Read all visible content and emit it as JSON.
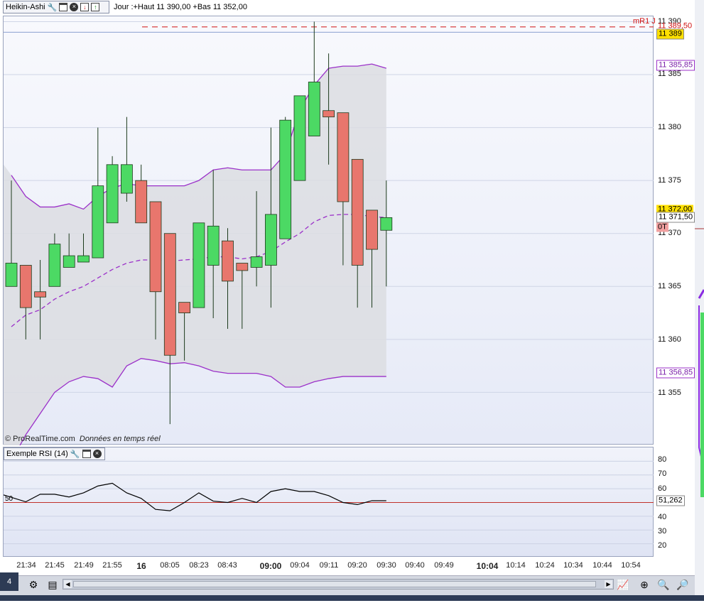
{
  "toolbar": {
    "indicator_name": "Heikin-Ashi",
    "day_info": "Jour :+Haut 11 390,00 +Bas 11 352,00",
    "rsi_name": "Exemple RSI (14)"
  },
  "watermark": {
    "source": "© ProRealTime.com",
    "note": "Données en temps réel"
  },
  "price_axis": {
    "ticks": [
      "11 390",
      "11 385",
      "11 380",
      "11 375",
      "11 370",
      "11 365",
      "11 360",
      "11 355"
    ],
    "tags": {
      "r1_label": "mR1 J",
      "r1_value": "11 389,50",
      "last_price": "11 389",
      "bb_upper": "11 385,85",
      "price_current": "11 372,00",
      "ma_value": "11 371,50",
      "ot_label": "0T",
      "bb_lower": "11 356,85"
    }
  },
  "rsi_axis": {
    "ticks": [
      "80",
      "70",
      "60",
      "50",
      "40",
      "30",
      "20"
    ],
    "level_label": "50",
    "current_value": "51,262"
  },
  "time_axis": {
    "labels": [
      "21:34",
      "21:45",
      "21:49",
      "21:55",
      "16",
      "08:05",
      "08:23",
      "08:43",
      "09:00",
      "09:04",
      "09:11",
      "09:20",
      "09:30",
      "09:40",
      "09:49",
      "10:04",
      "10:14",
      "10:24",
      "10:34",
      "10:44",
      "10:54"
    ],
    "bold": [
      "16",
      "09:00",
      "10:04"
    ]
  },
  "bottom": {
    "page_badge": "4"
  },
  "colors": {
    "bull": "#4cd964",
    "bear": "#e8766d",
    "band": "#9b30c9",
    "band_fill": "#dcdde2",
    "r1_line": "#d01010",
    "rsi_line": "#000000",
    "rsi_level": "#c0302b"
  },
  "chart_data": {
    "type": "candlestick",
    "ylim": [
      11350,
      11390.5
    ],
    "candles": [
      {
        "o": 11365,
        "c": 11367.2,
        "h": 11375,
        "l": 11365,
        "dir": "up"
      },
      {
        "o": 11367,
        "c": 11363,
        "h": 11367,
        "l": 11360,
        "dir": "down"
      },
      {
        "o": 11364.5,
        "c": 11364,
        "h": 11367.5,
        "l": 11360,
        "dir": "down"
      },
      {
        "o": 11365,
        "c": 11369,
        "h": 11370,
        "l": 11365,
        "dir": "up"
      },
      {
        "o": 11366.8,
        "c": 11367.9,
        "h": 11370,
        "l": 11366.8,
        "dir": "up"
      },
      {
        "o": 11367.3,
        "c": 11367.9,
        "h": 11370,
        "l": 11367.3,
        "dir": "up"
      },
      {
        "o": 11367.7,
        "c": 11374.5,
        "h": 11380,
        "l": 11367.7,
        "dir": "up"
      },
      {
        "o": 11371,
        "c": 11376.5,
        "h": 11377.3,
        "l": 11371,
        "dir": "up"
      },
      {
        "o": 11373.8,
        "c": 11376.5,
        "h": 11381,
        "l": 11373,
        "dir": "up"
      },
      {
        "o": 11375,
        "c": 11371,
        "h": 11376.5,
        "l": 11371,
        "dir": "down"
      },
      {
        "o": 11373,
        "c": 11364.5,
        "h": 11373,
        "l": 11360,
        "dir": "down"
      },
      {
        "o": 11370,
        "c": 11358.5,
        "h": 11370,
        "l": 11352,
        "dir": "down"
      },
      {
        "o": 11363.5,
        "c": 11362.5,
        "h": 11363.5,
        "l": 11358,
        "dir": "down"
      },
      {
        "o": 11363,
        "c": 11371,
        "h": 11371,
        "l": 11363,
        "dir": "up"
      },
      {
        "o": 11367,
        "c": 11370.7,
        "h": 11376,
        "l": 11362,
        "dir": "up"
      },
      {
        "o": 11369.3,
        "c": 11365.5,
        "h": 11370.5,
        "l": 11361,
        "dir": "down"
      },
      {
        "o": 11367.2,
        "c": 11366.5,
        "h": 11367.2,
        "l": 11361,
        "dir": "down"
      },
      {
        "o": 11366.8,
        "c": 11367.8,
        "h": 11374,
        "l": 11365,
        "dir": "up"
      },
      {
        "o": 11367,
        "c": 11371.8,
        "h": 11380,
        "l": 11363,
        "dir": "up"
      },
      {
        "o": 11369.5,
        "c": 11380.7,
        "h": 11381,
        "l": 11369.5,
        "dir": "up"
      },
      {
        "o": 11375,
        "c": 11383,
        "h": 11383,
        "l": 11375,
        "dir": "up"
      },
      {
        "o": 11379.2,
        "c": 11384.3,
        "h": 11390,
        "l": 11379.2,
        "dir": "up"
      },
      {
        "o": 11381.6,
        "c": 11381,
        "h": 11387,
        "l": 11376.5,
        "dir": "down"
      },
      {
        "o": 11381.4,
        "c": 11373,
        "h": 11381.4,
        "l": 11367,
        "dir": "down"
      },
      {
        "o": 11377,
        "c": 11367,
        "h": 11377,
        "l": 11363,
        "dir": "down"
      },
      {
        "o": 11372.2,
        "c": 11368.5,
        "h": 11372.2,
        "l": 11363,
        "dir": "down"
      },
      {
        "o": 11370.3,
        "c": 11371.5,
        "h": 11375,
        "l": 11365,
        "dir": "up"
      }
    ],
    "bb_upper": [
      11375.5,
      11373.5,
      11372.5,
      11372.5,
      11372.8,
      11372.3,
      11373.5,
      11374.3,
      11374.7,
      11374.5,
      11374.5,
      11374.5,
      11374.5,
      11375,
      11376,
      11376.2,
      11376,
      11376,
      11376,
      11377.5,
      11381.7,
      11384,
      11385.6,
      11385.8,
      11385.8,
      11386,
      11385.6
    ],
    "bb_lower": [
      11348.5,
      11351,
      11353,
      11355,
      11356,
      11356.5,
      11356.3,
      11355.5,
      11357.5,
      11358.2,
      11358,
      11357.7,
      11357.8,
      11357.5,
      11357,
      11356.8,
      11356.8,
      11356.8,
      11356.5,
      11355.5,
      11355.5,
      11356,
      11356.3,
      11356.5,
      11356.5,
      11356.5,
      11356.5
    ],
    "ma": [
      11361.2,
      11362.3,
      11362.8,
      11363.8,
      11364.5,
      11365,
      11365.8,
      11366.6,
      11367.2,
      11367.5,
      11367.5,
      11367.4,
      11367.5,
      11367.6,
      11367.8,
      11367.8,
      11367.6,
      11367.8,
      11368.3,
      11369.2,
      11370,
      11371.1,
      11371.7,
      11371.8,
      11371.8,
      11371.6,
      11371.5
    ],
    "r1": 11389.5,
    "rsi": {
      "ylim": [
        10,
        90
      ],
      "level": 50,
      "values": [
        55.5,
        50.5,
        56,
        56,
        54,
        57,
        62,
        64,
        57,
        53,
        45,
        44,
        50,
        57,
        51,
        50,
        53,
        50,
        58,
        60,
        58,
        58,
        55,
        50,
        48.5,
        51.3,
        51.3
      ]
    }
  }
}
